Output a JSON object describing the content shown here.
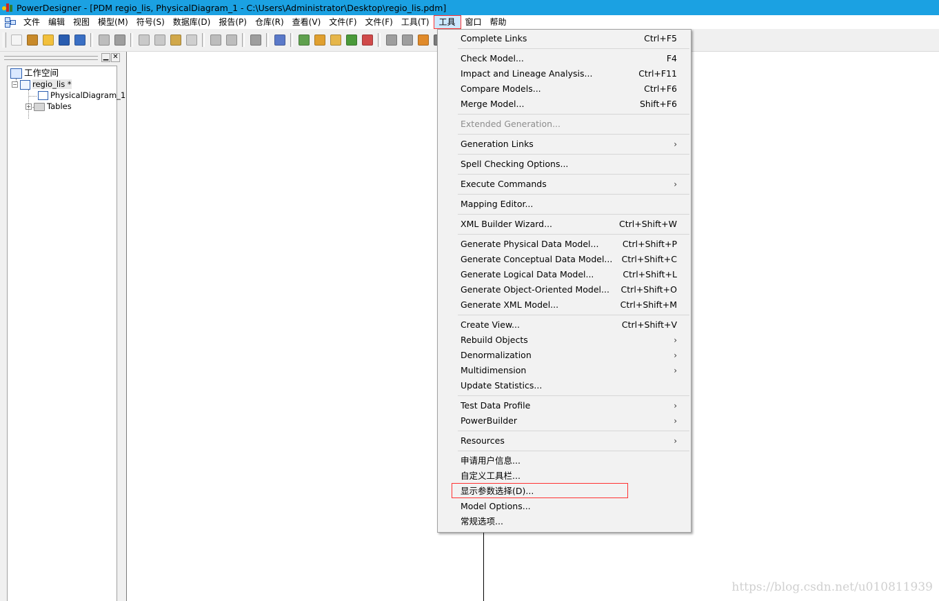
{
  "window": {
    "title": "PowerDesigner - [PDM regio_lis, PhysicalDiagram_1 - C:\\Users\\Administrator\\Desktop\\regio_lis.pdm]"
  },
  "menubar": {
    "items": [
      "文件",
      "编辑",
      "视图",
      "模型(M)",
      "符号(S)",
      "数据库(D)",
      "报告(P)",
      "仓库(R)",
      "查看(V)",
      "文件(F)",
      "文件(F)",
      "工具(T)",
      "工具",
      "窗口",
      "帮助"
    ],
    "active_index": 12
  },
  "toolbar": {
    "buttons": [
      {
        "icon": "new-model-icon",
        "color": "#f5f5f5"
      },
      {
        "icon": "new-project-icon",
        "color": "#c88a2a"
      },
      {
        "icon": "open-icon",
        "color": "#f2c03c"
      },
      {
        "icon": "save-icon",
        "color": "#2a5db0"
      },
      {
        "icon": "save-all-icon",
        "color": "#3a6fc4"
      },
      {
        "sep": true
      },
      {
        "icon": "print-preview-icon",
        "color": "#bdbdbd"
      },
      {
        "icon": "print-icon",
        "color": "#9e9e9e"
      },
      {
        "sep": true
      },
      {
        "icon": "cut-icon",
        "color": "#c9c9c9"
      },
      {
        "icon": "copy-icon",
        "color": "#c9c9c9"
      },
      {
        "icon": "paste-icon",
        "color": "#d1a84a"
      },
      {
        "icon": "delete-icon",
        "color": "#cfcfcf"
      },
      {
        "sep": true
      },
      {
        "icon": "undo-icon",
        "color": "#bdbdbd"
      },
      {
        "icon": "redo-icon",
        "color": "#bdbdbd"
      },
      {
        "sep": true
      },
      {
        "icon": "properties-icon",
        "color": "#9e9e9e"
      },
      {
        "sep": true
      },
      {
        "icon": "check-model-icon",
        "color": "#5a79c9"
      },
      {
        "sep": true
      },
      {
        "icon": "browser-icon",
        "color": "#5fa04e"
      },
      {
        "icon": "output-icon",
        "color": "#e0a030"
      },
      {
        "icon": "result-icon",
        "color": "#e6b64a"
      },
      {
        "icon": "refresh-icon",
        "color": "#4a9a3a"
      },
      {
        "icon": "report-icon",
        "color": "#d04a4a"
      },
      {
        "sep": true
      },
      {
        "icon": "symbol-icon",
        "color": "#9e9e9e"
      },
      {
        "icon": "format-icon",
        "color": "#9e9e9e"
      },
      {
        "icon": "brush-icon",
        "color": "#e08a2a"
      },
      {
        "icon": "pointer-icon",
        "color": "#7a7a7a"
      },
      {
        "icon": "text-color-icon",
        "color": "#2e9a2e"
      }
    ]
  },
  "tree": {
    "workspace": "工作空间",
    "model": "regio_lis *",
    "diagram": "PhysicalDiagram_1",
    "folder": "Tables"
  },
  "dropdown": {
    "items": [
      {
        "label": "Complete Links",
        "shortcut": "Ctrl+F5"
      },
      {
        "sep": true
      },
      {
        "label": "Check Model...",
        "shortcut": "F4"
      },
      {
        "label": "Impact and Lineage Analysis...",
        "shortcut": "Ctrl+F11"
      },
      {
        "label": "Compare Models...",
        "shortcut": "Ctrl+F6"
      },
      {
        "label": "Merge Model...",
        "shortcut": "Shift+F6"
      },
      {
        "sep": true
      },
      {
        "label": "Extended Generation...",
        "disabled": true
      },
      {
        "sep": true
      },
      {
        "label": "Generation Links",
        "submenu": true
      },
      {
        "sep": true
      },
      {
        "label": "Spell Checking Options..."
      },
      {
        "sep": true
      },
      {
        "label": "Execute Commands",
        "submenu": true
      },
      {
        "sep": true
      },
      {
        "label": "Mapping Editor..."
      },
      {
        "sep": true
      },
      {
        "label": "XML Builder Wizard...",
        "shortcut": "Ctrl+Shift+W"
      },
      {
        "sep": true
      },
      {
        "label": "Generate Physical Data Model...",
        "shortcut": "Ctrl+Shift+P"
      },
      {
        "label": "Generate Conceptual Data Model...",
        "shortcut": "Ctrl+Shift+C"
      },
      {
        "label": "Generate Logical Data Model...",
        "shortcut": "Ctrl+Shift+L"
      },
      {
        "label": "Generate Object-Oriented Model...",
        "shortcut": "Ctrl+Shift+O"
      },
      {
        "label": "Generate XML Model...",
        "shortcut": "Ctrl+Shift+M"
      },
      {
        "sep": true
      },
      {
        "label": "Create View...",
        "shortcut": "Ctrl+Shift+V"
      },
      {
        "label": "Rebuild Objects",
        "submenu": true
      },
      {
        "label": "Denormalization",
        "submenu": true
      },
      {
        "label": "Multidimension",
        "submenu": true
      },
      {
        "label": "Update Statistics..."
      },
      {
        "sep": true
      },
      {
        "label": "Test Data Profile",
        "submenu": true
      },
      {
        "label": "PowerBuilder",
        "submenu": true
      },
      {
        "sep": true
      },
      {
        "label": "Resources",
        "submenu": true
      },
      {
        "sep": true
      },
      {
        "label": "申请用户信息..."
      },
      {
        "label": "自定义工具栏..."
      },
      {
        "label": "显示参数选择(D)...",
        "highlighted": true
      },
      {
        "label": "Model Options..."
      },
      {
        "label": "常规选项..."
      }
    ]
  },
  "watermark": "https://blog.csdn.net/u010811939",
  "colors": {
    "titlebar": "#1ba1e2",
    "highlight_border": "#ff3030",
    "menu_background": "#f2f2f2"
  }
}
